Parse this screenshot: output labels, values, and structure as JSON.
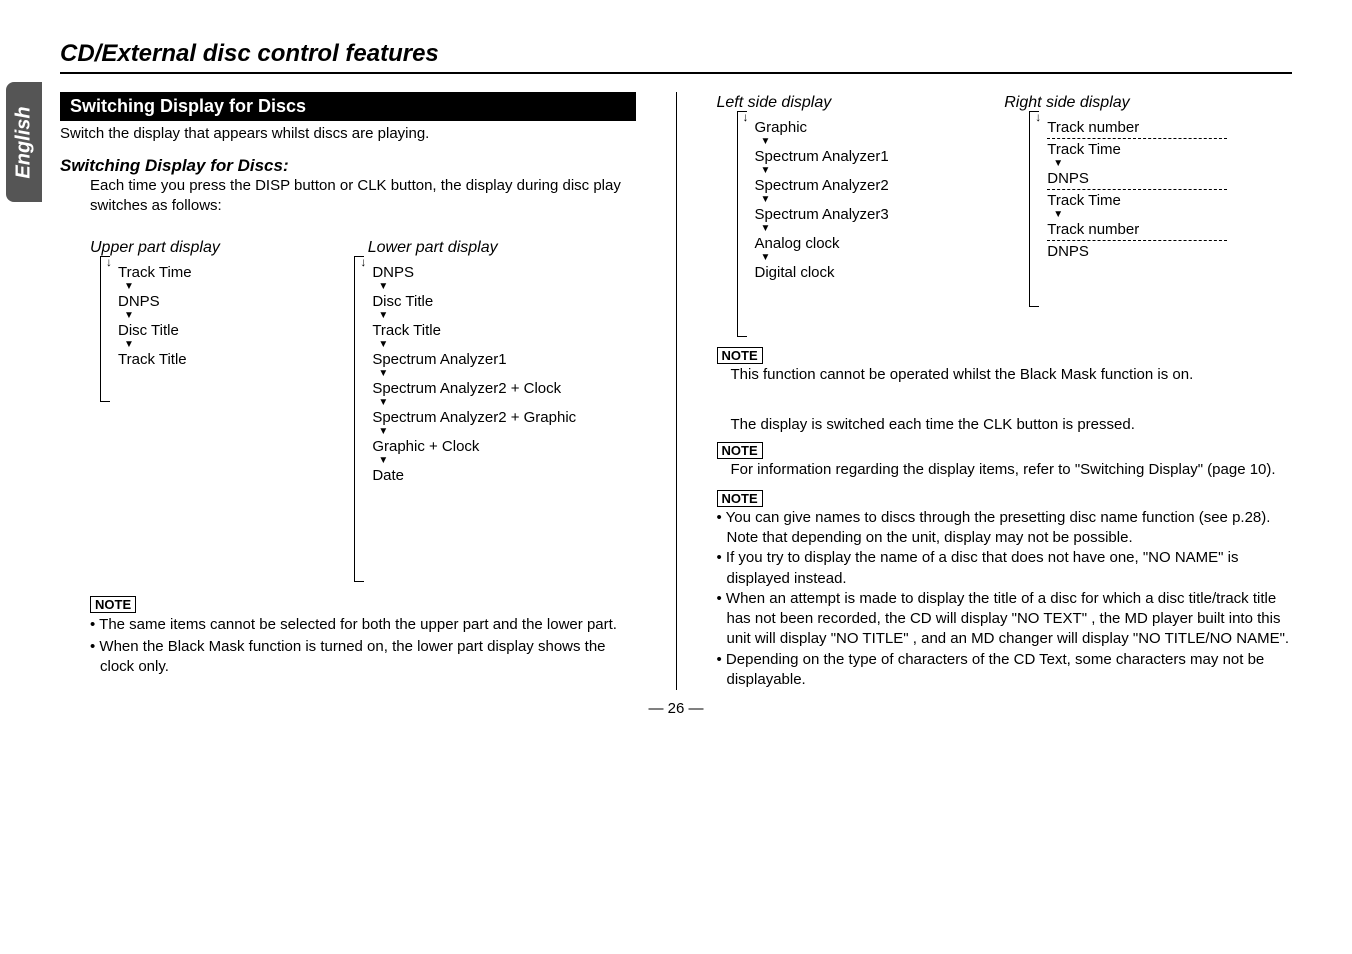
{
  "sidebar": {
    "language": "English"
  },
  "section_title": "CD/External disc control features",
  "black_bar": "Switching Display for Discs",
  "intro": "Switch the display that appears whilst discs are playing.",
  "subhead": "Switching Display for Discs:",
  "subbody": "Each time you press the DISP button or CLK button, the display during disc play switches as follows:",
  "labels": {
    "upper": "Upper part display",
    "lower": "Lower part display",
    "left_side": "Left side display",
    "right_side": "Right side display"
  },
  "upper_flow": [
    "Track Time",
    "DNPS",
    "Disc Title",
    "Track Title"
  ],
  "lower_flow": [
    "DNPS",
    "Disc Title",
    "Track Title",
    "Spectrum Analyzer1",
    "Spectrum Analyzer2 + Clock",
    "Spectrum Analyzer2 + Graphic",
    "Graphic + Clock",
    "Date"
  ],
  "left_note_label": "NOTE",
  "left_notes": [
    "The same items cannot be selected for both the upper part and the lower part.",
    "When the Black Mask function is turned on, the lower part display shows the clock only."
  ],
  "left_side_flow": [
    "Graphic",
    "Spectrum Analyzer1",
    "Spectrum Analyzer2",
    "Spectrum Analyzer3",
    "Analog clock",
    "Digital clock"
  ],
  "right_side_groups": [
    [
      "Track number",
      "Track Time",
      "DNPS"
    ],
    [
      "Track Time",
      "Track number",
      "DNPS"
    ]
  ],
  "r_note1_label": "NOTE",
  "r_note1_text": "This function cannot be operated whilst the Black Mask function is on.",
  "r_mid_text": "The display is switched each time the CLK button is pressed.",
  "r_note2_label": "NOTE",
  "r_note2_text": "For information regarding the display items, refer to \"Switching Display\" (page 10).",
  "r_note3_label": "NOTE",
  "r_notes_list": [
    "You can give names to discs through the presetting disc name function  (see p.28).\nNote that depending on the unit, display may not be possible.",
    "If you try to display the name of a disc that does not have one, \"NO NAME\" is displayed instead.",
    "When an attempt is made to display the title of a disc for which a disc title/track title has not been recorded, the CD will display \"NO TEXT\" , the MD player built into this unit will display \"NO TITLE\" , and an MD changer will display \"NO TITLE/NO NAME\".",
    "Depending on the type of characters of the CD Text, some characters may not be displayable."
  ],
  "page_number": "— 26 —"
}
